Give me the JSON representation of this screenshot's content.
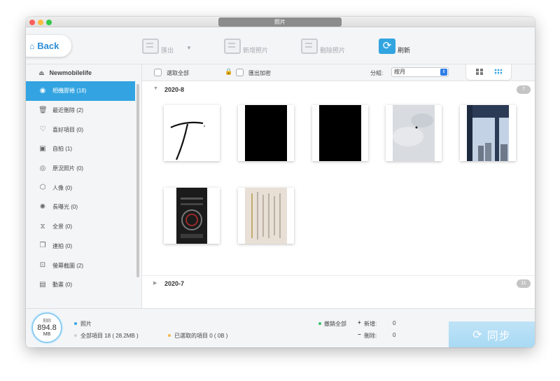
{
  "window": {
    "title": "照片"
  },
  "toolbar": {
    "back_label": "Back",
    "export_label": "匯出",
    "add_label": "新增照片",
    "delete_label": "刪除照片",
    "refresh_label": "刷新"
  },
  "sidebar": {
    "device_name": "Newmobilelife",
    "items": [
      {
        "label": "相機膠捲 (18)",
        "icon": "camera-icon",
        "glyph": "◉",
        "active": true
      },
      {
        "label": "最近刪除 (2)",
        "icon": "trash-icon",
        "glyph": "🗑"
      },
      {
        "label": "喜好項目 (0)",
        "icon": "heart-icon",
        "glyph": "♡"
      },
      {
        "label": "自拍 (1)",
        "icon": "selfie-icon",
        "glyph": "▣"
      },
      {
        "label": "原況照片 (0)",
        "icon": "live-photo-icon",
        "glyph": "◎"
      },
      {
        "label": "人像 (0)",
        "icon": "portrait-icon",
        "glyph": "⬡"
      },
      {
        "label": "長曝光 (0)",
        "icon": "long-exposure-icon",
        "glyph": "✺"
      },
      {
        "label": "全景 (0)",
        "icon": "panorama-icon",
        "glyph": "⧖"
      },
      {
        "label": "連拍 (0)",
        "icon": "burst-icon",
        "glyph": "❐"
      },
      {
        "label": "螢幕截圖 (2)",
        "icon": "screenshot-icon",
        "glyph": "⊡"
      },
      {
        "label": "動畫 (0)",
        "icon": "animated-icon",
        "glyph": "▤"
      }
    ]
  },
  "content_toolbar": {
    "select_all_label": "選取全部",
    "export_encrypt_label": "匯出加密",
    "group_label": "分組:",
    "group_value": "按月"
  },
  "groups": [
    {
      "title": "2020-8",
      "count": "7",
      "expanded": true
    },
    {
      "title": "2020-7",
      "count": "11",
      "expanded": false
    }
  ],
  "status": {
    "storage_label": "剩餘",
    "storage_value": "894.8",
    "storage_unit": "MB",
    "category_label": "照片",
    "total_label": "全部項目 18 ( 28.2MB )",
    "selected_label": "已選取的項目 0 ( 0B )",
    "undo_all_label": "撤銷全部",
    "added_label": "新增:",
    "added_value": "0",
    "deleted_label": "刪除:",
    "deleted_value": "0",
    "sync_label": "同步"
  },
  "colors": {
    "accent": "#33a4e1",
    "sync_button": "#a8d9f4"
  }
}
